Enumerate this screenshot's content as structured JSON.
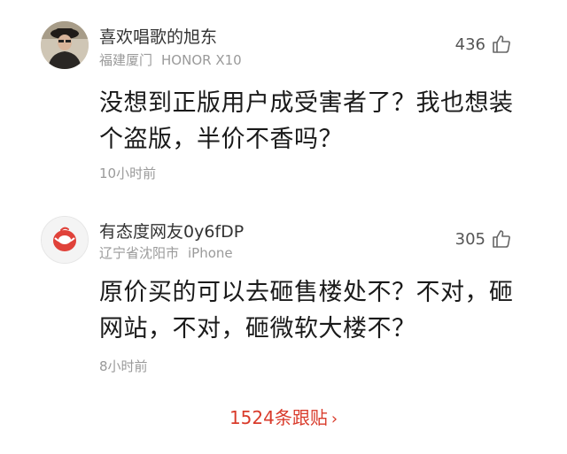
{
  "comments": [
    {
      "username": "喜欢唱歌的旭东",
      "location": "福建厦门",
      "device": "HONOR X10",
      "likes": "436",
      "content": "没想到正版用户成受害者了？我也想装个盗版，半价不香吗？",
      "time": "10小时前",
      "avatar_icon": "person-photo-avatar",
      "like_icon": "thumbs-up-icon"
    },
    {
      "username": "有态度网友0y6fDP",
      "location": "辽宁省沈阳市",
      "device": "iPhone",
      "likes": "305",
      "content": "原价买的可以去砸售楼处不？不对，砸网站，不对，砸微软大楼不？",
      "time": "8小时前",
      "avatar_icon": "netease-logo-avatar",
      "like_icon": "thumbs-up-icon"
    }
  ],
  "footer": {
    "more_replies_label": "1524条跟贴",
    "chevron": "›"
  },
  "colors": {
    "accent": "#d93b2b",
    "meta_text": "#9a9a9a",
    "body_text": "#1a1a1a"
  }
}
